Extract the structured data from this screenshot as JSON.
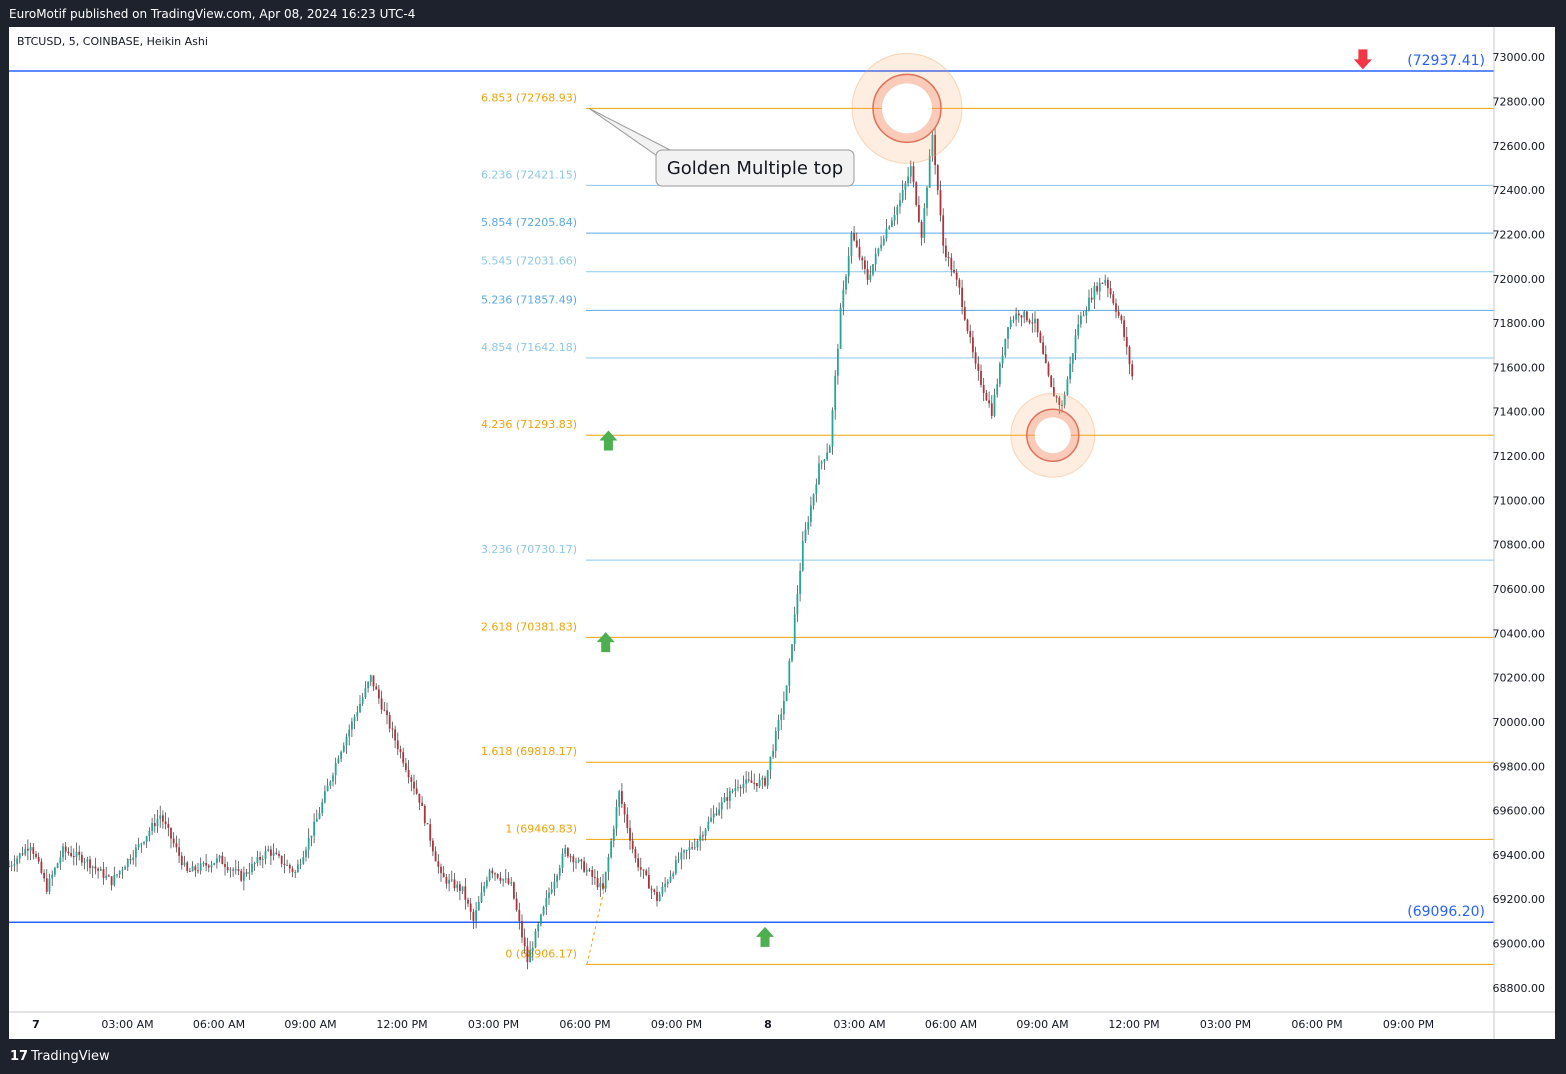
{
  "header": {
    "publisher_text": "EuroMotif published on TradingView.com, Apr 08, 2024 16:23 UTC-4"
  },
  "footer": {
    "brand_mark": "17",
    "brand_name": "TradingView"
  },
  "chart_data": {
    "type": "candlestick",
    "title": "BTCUSD, 5, COINBASE, Heikin Ashi",
    "symbol": "BTCUSD",
    "interval": "5",
    "exchange": "COINBASE",
    "style": "Heikin Ashi",
    "colors": {
      "up": "#26a69a",
      "down": "#b2323c",
      "fib_gold": "#f0a30a",
      "fib_blue": "#5aa9e6",
      "hline_blue": "#2962ff",
      "arrow_green": "#4caf50",
      "arrow_red": "#f23645",
      "circle": "#f7a35c"
    },
    "y_axis": {
      "range": [
        68700,
        73100
      ],
      "ticks": [
        "73000.00",
        "72800.00",
        "72600.00",
        "72400.00",
        "72200.00",
        "72000.00",
        "71800.00",
        "71600.00",
        "71400.00",
        "71200.00",
        "71000.00",
        "70800.00",
        "70600.00",
        "70400.00",
        "70200.00",
        "70000.00",
        "69800.00",
        "69600.00",
        "69400.00",
        "69200.00",
        "69000.00",
        "68800.00"
      ]
    },
    "x_axis": {
      "ticks": [
        "7",
        "03:00 AM",
        "06:00 AM",
        "09:00 AM",
        "12:00 PM",
        "03:00 PM",
        "06:00 PM",
        "09:00 PM",
        "8",
        "03:00 AM",
        "06:00 AM",
        "09:00 AM",
        "12:00 PM",
        "03:00 PM",
        "06:00 PM",
        "09:00 PM"
      ],
      "bold_ticks": [
        "7",
        "8"
      ]
    },
    "horizontal_lines": [
      {
        "label": "(72937.41)",
        "price": 72937.41
      },
      {
        "label": "(69096.20)",
        "price": 69096.2
      }
    ],
    "fib_levels": [
      {
        "label": "6.853 (72768.93)",
        "ratio": 6.853,
        "price": 72768.93,
        "color": "gold"
      },
      {
        "label": "6.236 (72421.15)",
        "ratio": 6.236,
        "price": 72421.15,
        "color": "lightblue"
      },
      {
        "label": "5.854 (72205.84)",
        "ratio": 5.854,
        "price": 72205.84,
        "color": "blue"
      },
      {
        "label": "5.545 (72031.66)",
        "ratio": 5.545,
        "price": 72031.66,
        "color": "lightblue"
      },
      {
        "label": "5.236 (71857.49)",
        "ratio": 5.236,
        "price": 71857.49,
        "color": "blue"
      },
      {
        "label": "4.854 (71642.18)",
        "ratio": 4.854,
        "price": 71642.18,
        "color": "lightblue"
      },
      {
        "label": "4.236 (71293.83)",
        "ratio": 4.236,
        "price": 71293.83,
        "color": "gold"
      },
      {
        "label": "3.236 (70730.17)",
        "ratio": 3.236,
        "price": 70730.17,
        "color": "lightblue"
      },
      {
        "label": "2.618 (70381.83)",
        "ratio": 2.618,
        "price": 70381.83,
        "color": "gold"
      },
      {
        "label": "1.618 (69818.17)",
        "ratio": 1.618,
        "price": 69818.17,
        "color": "gold"
      },
      {
        "label": "1 (69469.83)",
        "ratio": 1,
        "price": 69469.83,
        "color": "gold"
      },
      {
        "label": "0 (68906.17)",
        "ratio": 0,
        "price": 68906.17,
        "color": "gold"
      }
    ],
    "annotations": [
      {
        "type": "callout",
        "text": "Golden Multiple top",
        "anchor_price": 72768.93
      },
      {
        "type": "arrow-up",
        "price": 71270,
        "time_index": 182
      },
      {
        "type": "arrow-up",
        "price": 70360,
        "time_index": 181
      },
      {
        "type": "arrow-up",
        "price": 69030,
        "time_index": 240
      },
      {
        "type": "arrow-down",
        "price": 72990,
        "time_index": 447
      },
      {
        "type": "circle",
        "price": 72768.93,
        "time_index": 330
      },
      {
        "type": "circle",
        "price": 71293.83,
        "time_index": 384
      }
    ],
    "series": [
      {
        "name": "BTCUSD",
        "anchors": [
          [
            0,
            69350
          ],
          [
            8,
            69450
          ],
          [
            14,
            69250
          ],
          [
            20,
            69420
          ],
          [
            28,
            69380
          ],
          [
            38,
            69280
          ],
          [
            48,
            69440
          ],
          [
            56,
            69580
          ],
          [
            66,
            69320
          ],
          [
            78,
            69380
          ],
          [
            86,
            69300
          ],
          [
            96,
            69420
          ],
          [
            106,
            69320
          ],
          [
            114,
            69560
          ],
          [
            122,
            69850
          ],
          [
            134,
            70200
          ],
          [
            142,
            69950
          ],
          [
            152,
            69650
          ],
          [
            160,
            69300
          ],
          [
            168,
            69240
          ],
          [
            172,
            69100
          ],
          [
            178,
            69340
          ],
          [
            186,
            69260
          ],
          [
            192,
            68920
          ],
          [
            200,
            69230
          ],
          [
            206,
            69420
          ],
          [
            214,
            69330
          ],
          [
            220,
            69240
          ],
          [
            226,
            69680
          ],
          [
            232,
            69380
          ],
          [
            240,
            69200
          ],
          [
            248,
            69380
          ],
          [
            254,
            69450
          ],
          [
            262,
            69600
          ],
          [
            270,
            69720
          ],
          [
            280,
            69730
          ],
          [
            288,
            70150
          ],
          [
            294,
            70800
          ],
          [
            300,
            71150
          ],
          [
            304,
            71250
          ],
          [
            308,
            71850
          ],
          [
            312,
            72200
          ],
          [
            318,
            72000
          ],
          [
            324,
            72200
          ],
          [
            330,
            72350
          ],
          [
            334,
            72500
          ],
          [
            338,
            72200
          ],
          [
            342,
            72650
          ],
          [
            346,
            72150
          ],
          [
            352,
            71950
          ],
          [
            358,
            71600
          ],
          [
            364,
            71400
          ],
          [
            370,
            71800
          ],
          [
            374,
            71850
          ],
          [
            380,
            71800
          ],
          [
            386,
            71500
          ],
          [
            390,
            71420
          ],
          [
            396,
            71800
          ],
          [
            402,
            71950
          ],
          [
            406,
            72000
          ],
          [
            412,
            71800
          ],
          [
            416,
            71560
          ]
        ]
      }
    ]
  }
}
